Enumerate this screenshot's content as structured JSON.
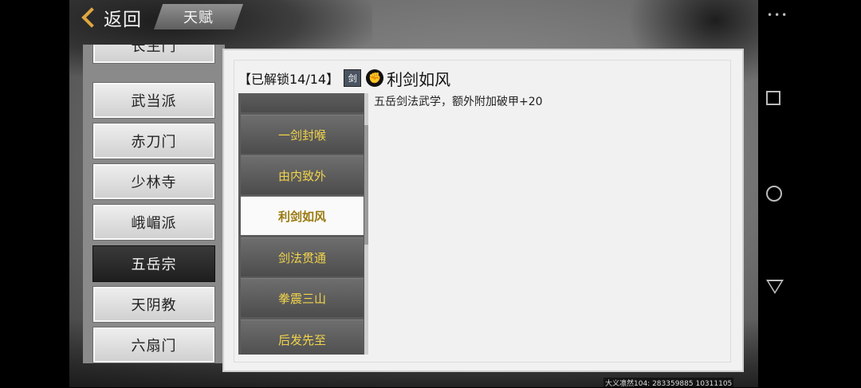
{
  "back_label": "返回",
  "page_tab": "天赋",
  "sects": [
    "长生门",
    "武当派",
    "赤刀门",
    "少林寺",
    "峨嵋派",
    "五岳宗",
    "天阴教",
    "六扇门"
  ],
  "selected_sect_index": 5,
  "unlock_status": "【已解锁14/14】",
  "badge_text": "剑",
  "selected_skill": "利剑如风",
  "skill_description": "五岳剑法武学，额外附加破甲+20",
  "skills": [
    "",
    "一剑封喉",
    "由内致外",
    "利剑如风",
    "剑法贯通",
    "拳震三山",
    "后发先至"
  ],
  "selected_skill_index": 3,
  "footer_id": "大义凛然104: 283359885  10311105",
  "nav_dots": "•••"
}
